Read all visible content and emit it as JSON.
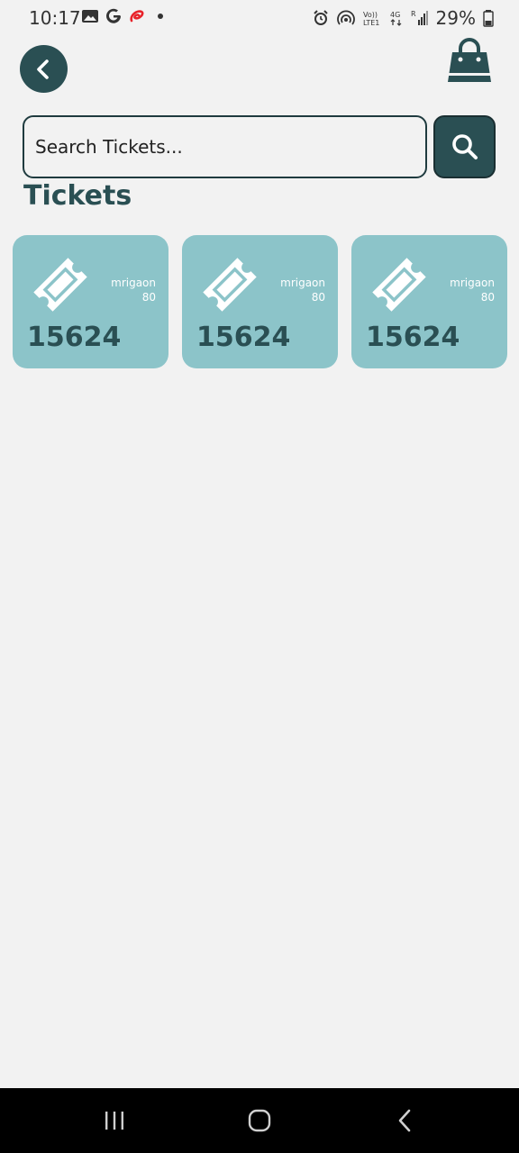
{
  "status_bar": {
    "time": "10:17",
    "left_icons": [
      "image-icon",
      "google-icon",
      "airtel-icon",
      "dot-icon"
    ],
    "right_icons": [
      "alarm-icon",
      "hotspot-icon",
      "volte-icon",
      "signal-4g-icon",
      "signal-bars-icon",
      "battery-icon"
    ],
    "battery": "29%"
  },
  "header": {
    "back_icon": "chevron-left-icon",
    "cart_icon": "shopping-bag-icon"
  },
  "search": {
    "placeholder": "Search Tickets...",
    "value": "",
    "button_icon": "search-icon"
  },
  "section_title": "Tickets",
  "tickets": [
    {
      "location": "mrigaon",
      "count": "80",
      "number": "15624"
    },
    {
      "location": "mrigaon",
      "count": "80",
      "number": "15624"
    },
    {
      "location": "mrigaon",
      "count": "80",
      "number": "15624"
    }
  ],
  "nav_bar": {
    "buttons": [
      "recents-icon",
      "home-icon",
      "back-icon"
    ]
  },
  "colors": {
    "primary": "#2a4f53",
    "card": "#8cc4c9",
    "background": "#f2f2f2"
  }
}
